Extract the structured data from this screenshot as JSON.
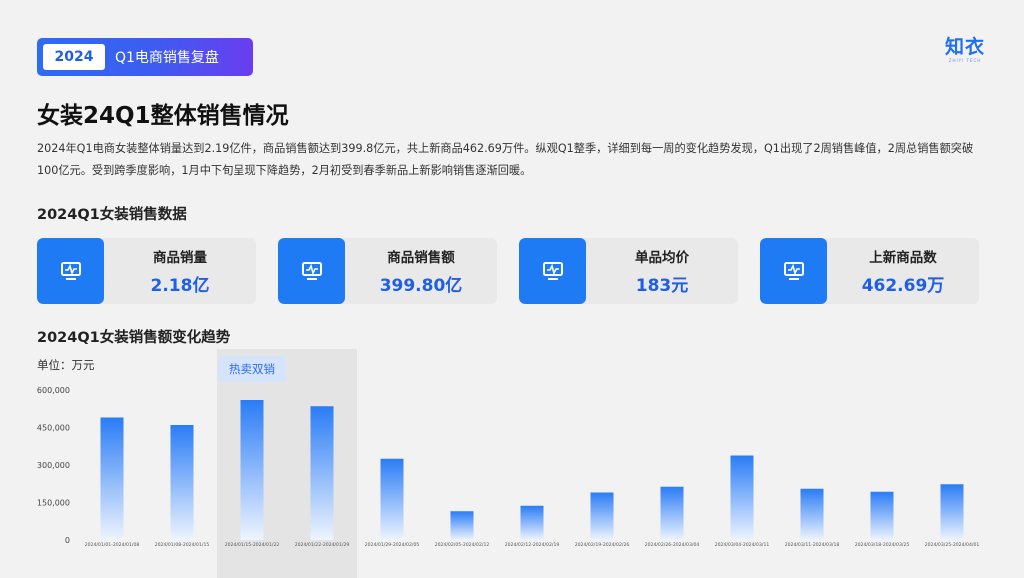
{
  "badge": {
    "year": "2024",
    "title": "Q1电商销售复盘"
  },
  "logo": {
    "main": "知衣",
    "sub": "ZHIYI TECH"
  },
  "page_title": "女装24Q1整体销售情况",
  "summary": "2024年Q1电商女装整体销量达到2.19亿件，商品销售额达到399.8亿元，共上新商品462.69万件。纵观Q1整季，详细到每一周的变化趋势发现，Q1出现了2周销售峰值，2周总销售额突破100亿元。受到跨季度影响，1月中下旬呈现下降趋势，2月初受到春季新品上新影响销售逐渐回暖。",
  "kpi_section_title": "2024Q1女装销售数据",
  "kpis": [
    {
      "label": "商品销量",
      "value": "2.18亿",
      "icon": "monitor-chart-icon"
    },
    {
      "label": "商品销售额",
      "value": "399.80亿",
      "icon": "monitor-chart-icon"
    },
    {
      "label": "单品均价",
      "value": "183元",
      "icon": "monitor-chart-icon"
    },
    {
      "label": "上新商品数",
      "value": "462.69万",
      "icon": "monitor-chart-icon"
    }
  ],
  "chart_section_title": "2024Q1女装销售额变化趋势",
  "unit_label": "单位：万元",
  "colors": {
    "accent": "#1f7bf4",
    "bar_top": "#2a7cf6",
    "bar_bottom": "#eef4fe",
    "highlight_bg": "#e4e4e4"
  },
  "chart_data": {
    "type": "bar",
    "categories": [
      "2024/01/01-2024/01/08",
      "2024/01/08-2024/01/15",
      "2024/01/15-2024/01/22",
      "2024/01/22-2024/01/29",
      "2024/01/29-2024/02/05",
      "2024/02/05-2024/02/12",
      "2024/02/12-2024/02/19",
      "2024/02/19-2024/02/26",
      "2024/02/26-2024/03/04",
      "2024/03/04-2024/03/11",
      "2024/03/11-2024/03/18",
      "2024/03/18-2024/03/25",
      "2024/03/25-2024/04/01"
    ],
    "values": [
      490000,
      460000,
      560000,
      535000,
      325000,
      115000,
      137000,
      190000,
      213000,
      338000,
      205000,
      193000,
      223000
    ],
    "ylim": [
      0,
      600000
    ],
    "yticks": [
      0,
      150000,
      300000,
      450000,
      600000
    ],
    "ytick_labels": [
      "0",
      "150,000",
      "300,000",
      "450,000",
      "600,000"
    ],
    "highlight": {
      "label": "热卖双销",
      "categories": [
        2,
        3
      ]
    },
    "ylabel": "单位：万元",
    "grid": false
  }
}
